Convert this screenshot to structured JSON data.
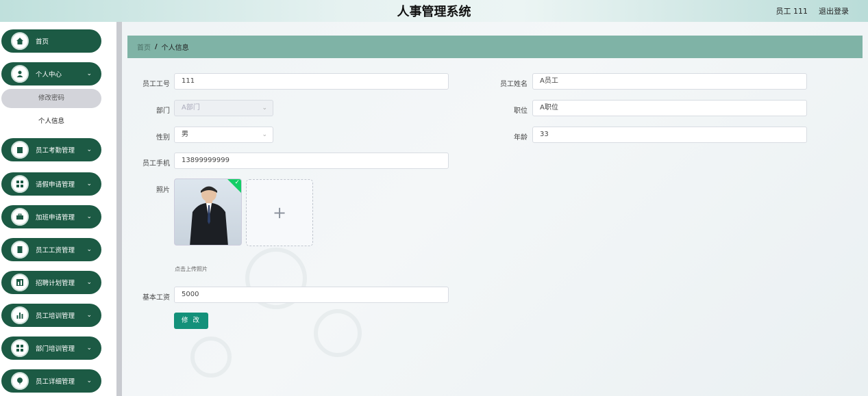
{
  "header": {
    "title": "人事管理系统",
    "user": "员工 111",
    "logout": "退出登录"
  },
  "sidebar": {
    "items": [
      {
        "label": "首页",
        "icon": "home-icon"
      },
      {
        "label": "个人中心",
        "icon": "user-icon"
      },
      {
        "label": "员工考勤管理",
        "icon": "clipboard-icon"
      },
      {
        "label": "请假申请管理",
        "icon": "grid-icon"
      },
      {
        "label": "加班申请管理",
        "icon": "briefcase-icon"
      },
      {
        "label": "员工工资管理",
        "icon": "document-icon"
      },
      {
        "label": "招聘计划管理",
        "icon": "chart-icon"
      },
      {
        "label": "员工培训管理",
        "icon": "bar-chart-icon"
      },
      {
        "label": "部门培训管理",
        "icon": "grid-icon"
      },
      {
        "label": "员工详细管理",
        "icon": "balloon-icon"
      }
    ],
    "sub_items": [
      {
        "label": "修改密码"
      },
      {
        "label": "个人信息"
      }
    ]
  },
  "breadcrumb": {
    "home": "首页",
    "sep": "/",
    "current": "个人信息"
  },
  "form": {
    "emp_no_label": "员工工号",
    "emp_no": "111",
    "name_label": "员工姓名",
    "name": "A员工",
    "dept_label": "部门",
    "dept": "A部门",
    "position_label": "职位",
    "position": "A职位",
    "gender_label": "性别",
    "gender": "男",
    "age_label": "年龄",
    "age": "33",
    "phone_label": "员工手机",
    "phone": "13899999999",
    "photo_label": "照片",
    "upload_tip": "点击上传照片",
    "salary_label": "基本工资",
    "salary": "5000",
    "submit": "修 改"
  },
  "colors": {
    "sidebar": "#1c5a44",
    "breadcrumb": "#7fb3a6",
    "button": "#14917a"
  }
}
